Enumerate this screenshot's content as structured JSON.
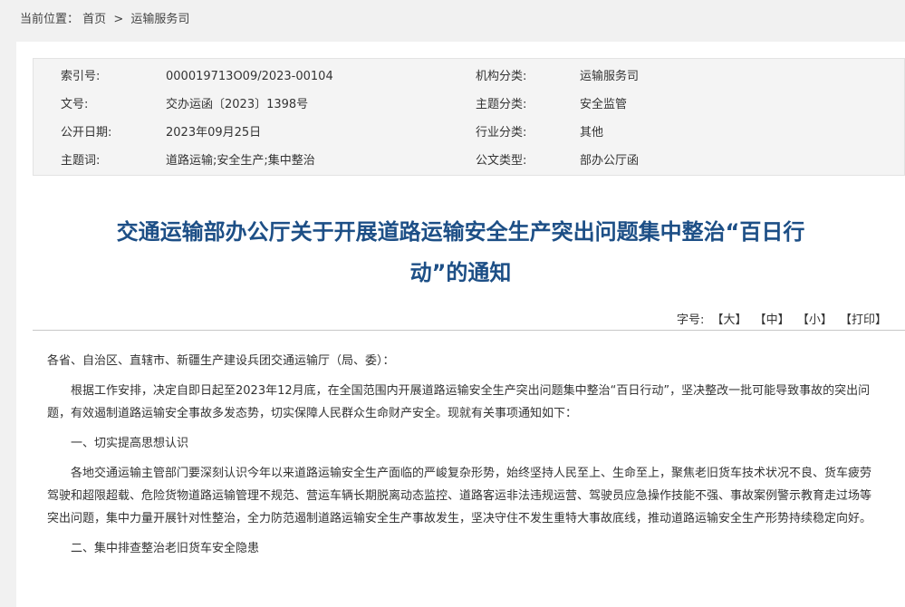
{
  "breadcrumb": {
    "label": "当前位置：",
    "home": "首页",
    "separator": ">",
    "current": "运输服务司"
  },
  "meta": [
    {
      "k1": "索引号:",
      "v1": "000019713O09/2023-00104",
      "k2": "机构分类:",
      "v2": "运输服务司"
    },
    {
      "k1": "文号:",
      "v1": "交办运函〔2023〕1398号",
      "k2": "主题分类:",
      "v2": "安全监管"
    },
    {
      "k1": "公开日期:",
      "v1": "2023年09月25日",
      "k2": "行业分类:",
      "v2": "其他"
    },
    {
      "k1": "主题词:",
      "v1": "道路运输;安全生产;集中整治",
      "k2": "公文类型:",
      "v2": "部办公厅函"
    }
  ],
  "title": {
    "line1": "交通运输部办公厅关于开展道路运输安全生产突出问题集中整治“百日行",
    "line2": "动”的通知"
  },
  "font_size_bar": {
    "label": "字号:",
    "large": "【大】",
    "medium": "【中】",
    "small": "【小】",
    "print": "【打印】"
  },
  "body": {
    "salutation": "各省、自治区、直辖市、新疆生产建设兵团交通运输厅（局、委）：",
    "p1": "根据工作安排，决定自即日起至2023年12月底，在全国范围内开展道路运输安全生产突出问题集中整治“百日行动”，坚决整改一批可能导致事故的突出问题，有效遏制道路运输安全事故多发态势，切实保障人民群众生命财产安全。现就有关事项通知如下：",
    "h1": "一、切实提高思想认识",
    "p2": "各地交通运输主管部门要深刻认识今年以来道路运输安全生产面临的严峻复杂形势，始终坚持人民至上、生命至上，聚焦老旧货车技术状况不良、货车疲劳驾驶和超限超载、危险货物道路运输管理不规范、营运车辆长期脱离动态监控、道路客运非法违规运营、驾驶员应急操作技能不强、事故案例警示教育走过场等突出问题，集中力量开展针对性整治，全力防范遏制道路运输安全生产事故发生，坚决守住不发生重特大事故底线，推动道路运输安全生产形势持续稳定向好。",
    "h2": "二、集中排查整治老旧货车安全隐患"
  }
}
